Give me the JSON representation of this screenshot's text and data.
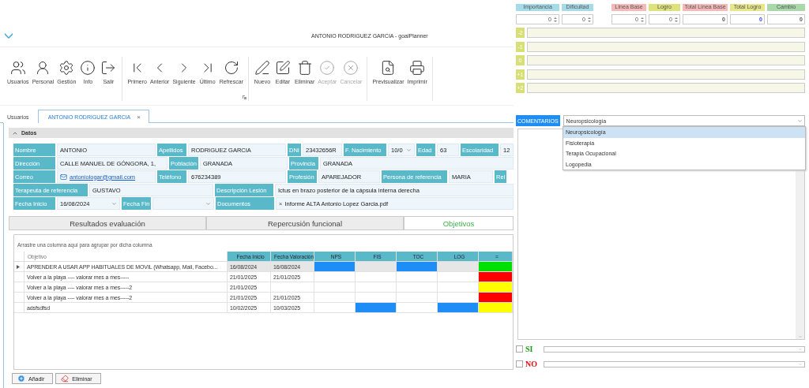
{
  "window": {
    "title": "ANTONIO RODRIGUEZ GARCIA - goalPlanner"
  },
  "ribbon": [
    {
      "buttons": [
        {
          "label": "Usuarios",
          "disabled": false
        },
        {
          "label": "Personal",
          "disabled": false
        },
        {
          "label": "Gestión",
          "disabled": false
        },
        {
          "label": "Info",
          "disabled": false
        },
        {
          "label": "Salir",
          "disabled": false
        }
      ]
    },
    {
      "buttons": [
        {
          "label": "Primero",
          "disabled": false
        },
        {
          "label": "Anterior",
          "disabled": false
        },
        {
          "label": "Siguiente",
          "disabled": false
        },
        {
          "label": "Último",
          "disabled": false
        },
        {
          "label": "Refrescar",
          "disabled": false
        }
      ],
      "launcher": true
    },
    {
      "buttons": [
        {
          "label": "Nuevo",
          "disabled": false
        },
        {
          "label": "Editar",
          "disabled": false
        },
        {
          "label": "Eliminar",
          "disabled": false
        },
        {
          "label": "Aceptar",
          "disabled": true
        },
        {
          "label": "Cancelar",
          "disabled": true
        }
      ]
    },
    {
      "buttons": [
        {
          "label": "Previsualizar",
          "disabled": false
        },
        {
          "label": "Imprimir",
          "disabled": false
        }
      ]
    }
  ],
  "tabs": [
    {
      "label": "Usuarios",
      "selected": false
    },
    {
      "label": "ANTONIO RODRIGUEZ GARCIA",
      "selected": true,
      "close": "×"
    }
  ],
  "datos": {
    "title": "Datos",
    "expanded": true,
    "lines": [
      [
        {
          "label": "Nombre",
          "value": "ANTONIO",
          "kind": "text"
        },
        {
          "label": "Apellidos",
          "value": "RODRIGUEZ GARCIA",
          "kind": "text"
        },
        {
          "label": "DNI",
          "value": "23432656R",
          "kind": "text"
        },
        {
          "label": "F. Nacimiento",
          "value": "10/0",
          "kind": "date"
        },
        {
          "label": "Edad",
          "value": "63",
          "kind": "text"
        },
        {
          "label": "Escolaridad",
          "value": "12",
          "kind": "text"
        }
      ],
      [
        {
          "label": "Dirección",
          "value": "CALLE MANUEL DE GÓNGORA, 1,",
          "kind": "text"
        },
        {
          "label": "Población",
          "value": "GRANADA",
          "kind": "text"
        },
        {
          "label": "Provincia",
          "value": "GRANADA",
          "kind": "text"
        }
      ],
      [
        {
          "label": "Correo",
          "value": "antoniologar@gmail.com",
          "kind": "email"
        },
        {
          "label": "Teléfono",
          "value": "676234389",
          "kind": "text"
        },
        {
          "label": "Profesión",
          "value": "APAREJADOR",
          "kind": "text"
        },
        {
          "label": "Persona de referencia",
          "value": "MARIA",
          "kind": "text"
        },
        {
          "label": "Rel",
          "kind": "label"
        }
      ],
      [
        {
          "label": "Terapeuta de referencia",
          "value": "GUSTAVO",
          "kind": "text"
        },
        {
          "label": "Descripción Lesión",
          "value": "Ictus en brazo posterior de la cápsula interna derecha",
          "kind": "text"
        }
      ],
      [
        {
          "label": "Fecha Inicio",
          "value": "16/08/2024",
          "kind": "date"
        },
        {
          "label": "Fecha Fin",
          "kind": "date"
        },
        {
          "label": "Documentos",
          "value": "Informe ALTA Antonio Lopez Garcia.pdf",
          "remove": "×",
          "kind": "file"
        }
      ]
    ]
  },
  "subtabs": [
    {
      "label": "Resultados evaluación",
      "selected": false
    },
    {
      "label": "Repercusión funcional",
      "selected": false
    },
    {
      "label": "Objetivos",
      "selected": true
    }
  ],
  "grid": {
    "hint": "Arrastre una columna aquí para agrupar por dicha columna",
    "columns": [
      "Objetivo",
      "Fecha Inicio",
      "Fecha Valoración",
      "NPS",
      "FIS",
      "TOC",
      "LOG",
      "="
    ],
    "rows": [
      {
        "objetivo": "APRENDER A USAR APP HABITUALES DE MOVIL (Whatsapp, Mail, Facebo...",
        "fecha_inicio": "16/08/2024",
        "fecha_valoracion": "16/08/2024",
        "marks": [
          true,
          false,
          true,
          false
        ],
        "color": "#00e000",
        "selected": true
      },
      {
        "objetivo": "Volver a la playa ---- valorar mes a mes-----",
        "fecha_inicio": "21/01/2025",
        "fecha_valoracion": "21/01/2025",
        "marks": [
          false,
          false,
          false,
          false
        ],
        "color": "#ff0000",
        "selected": false
      },
      {
        "objetivo": "Volver a la playa ---- valorar mes a mes-----2",
        "fecha_inicio": "21/01/2025",
        "marks": [
          false,
          false,
          false,
          false
        ],
        "color": "#ffff00",
        "selected": false
      },
      {
        "objetivo": "Volver a la playa ---- valorar mes a mes-----2",
        "fecha_inicio": "21/01/2025",
        "fecha_valoracion": "21/01/2025",
        "marks": [
          false,
          false,
          false,
          false
        ],
        "color": "#ff0000",
        "selected": false
      },
      {
        "objetivo": "adsfsdfsd",
        "fecha_inicio": "10/02/2025",
        "fecha_valoracion": "10/03/2025",
        "marks": [
          false,
          true,
          false,
          true
        ],
        "color": "#ffff00",
        "selected": false
      }
    ]
  },
  "actions": [
    {
      "label": "Añadir",
      "kind": "add"
    },
    {
      "label": "Eliminar",
      "kind": "delete"
    }
  ],
  "scores": [
    {
      "label": "Importancia",
      "value": "0",
      "kind": "spinner",
      "color": "#a6dce8"
    },
    {
      "label": "Dificultad",
      "value": "0",
      "kind": "spinner",
      "color": "#a6dce8"
    },
    {
      "label": "Línea Base",
      "value": "0",
      "kind": "spinner",
      "color": "#f6b9b9"
    },
    {
      "label": "Logro",
      "value": "0",
      "kind": "spinner",
      "color": "#dde27c"
    },
    {
      "label": "Total Línea Base",
      "value": "0",
      "kind": "total",
      "color": "#f6b9b9"
    },
    {
      "label": "Total Logro",
      "value": "0",
      "kind": "total",
      "color": "#e6e68a",
      "focused": true
    },
    {
      "label": "Cambio",
      "value": "0",
      "kind": "total",
      "color": "#a9d8ab"
    }
  ],
  "levels": [
    "-2",
    "-1",
    "0",
    "+1",
    "+2"
  ],
  "comentarios": {
    "label": "COMENTARIOS",
    "value": "Neuropsicología",
    "open": true,
    "options": [
      {
        "label": "Neuropsicología",
        "selected": true
      },
      {
        "label": "Fisioterapia",
        "selected": false
      },
      {
        "label": "Terapia Ocupacional",
        "selected": false
      },
      {
        "label": "Logopedia",
        "selected": false
      }
    ]
  },
  "checks": [
    {
      "label": "SI",
      "checked": false,
      "color": "#1a9a1a"
    },
    {
      "label": "NO",
      "checked": false,
      "color": "#e01010"
    }
  ]
}
